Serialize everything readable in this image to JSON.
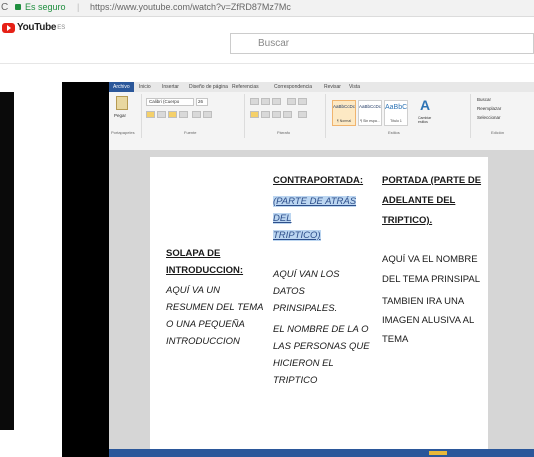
{
  "browser": {
    "secure_label": "Es seguro",
    "separator": "|",
    "url": "https://www.youtube.com/watch?v=ZfRD87Mz7Mc"
  },
  "youtube": {
    "logo_text": "YouTube",
    "country_code": "ES",
    "search_placeholder": "Buscar"
  },
  "word": {
    "tabs": [
      "Archivo",
      "Inicio",
      "Insertar",
      "Diseño de página",
      "Referencias",
      "Correspondencia",
      "Revisar",
      "Vista"
    ],
    "font_name": "Calibri (Cuerpo",
    "font_size": "26",
    "paste_label": "Pegar",
    "group_labels": [
      "Portapapeles",
      "Fuente",
      "Párrafo",
      "Estilos",
      "Edición"
    ],
    "styles": [
      {
        "sample": "AaBbCcDc",
        "name": "¶ Normal"
      },
      {
        "sample": "AaBbCcDc",
        "name": "¶ Sin espa..."
      },
      {
        "sample": "AaBbC",
        "name": "Título 1"
      }
    ],
    "change_styles": "Cambiar estilos",
    "editing": [
      "Buscar",
      "Reemplazar",
      "Seleccionar"
    ]
  },
  "document": {
    "col1": {
      "heading": [
        "SOLAPA DE",
        "INTRODUCCION:"
      ],
      "body": [
        "AQUÍ VA UN",
        "RESUMEN DEL TEMA",
        "O UNA PEQUEÑA",
        "INTRODUCCION"
      ]
    },
    "col2": {
      "heading": "CONTRAPORTADA:",
      "highlight": [
        "(PARTE DE ATRÁS DEL",
        "TRIPTICO)"
      ],
      "body1": [
        "AQUÍ VAN LOS DATOS",
        "PRINSIPALES."
      ],
      "body2": [
        "EL NOMBRE DE LA O",
        "LAS PERSONAS QUE",
        "HICIERON EL",
        "TRIPTICO"
      ]
    },
    "col3": {
      "heading": [
        "PORTADA (PARTE DE",
        "ADELANTE DEL",
        "TRIPTICO)."
      ],
      "body1": [
        "AQUÍ VA EL NOMBRE",
        "DEL TEMA PRINSIPAL"
      ],
      "body2": [
        "TAMBIEN IRA UNA",
        "IMAGEN ALUSIVA AL",
        "TEMA"
      ]
    }
  },
  "colors": {
    "youtube_red": "#e62117",
    "word_blue": "#2b579a",
    "secure_green": "#1e8e3e",
    "selection": "#bcd6f1"
  }
}
